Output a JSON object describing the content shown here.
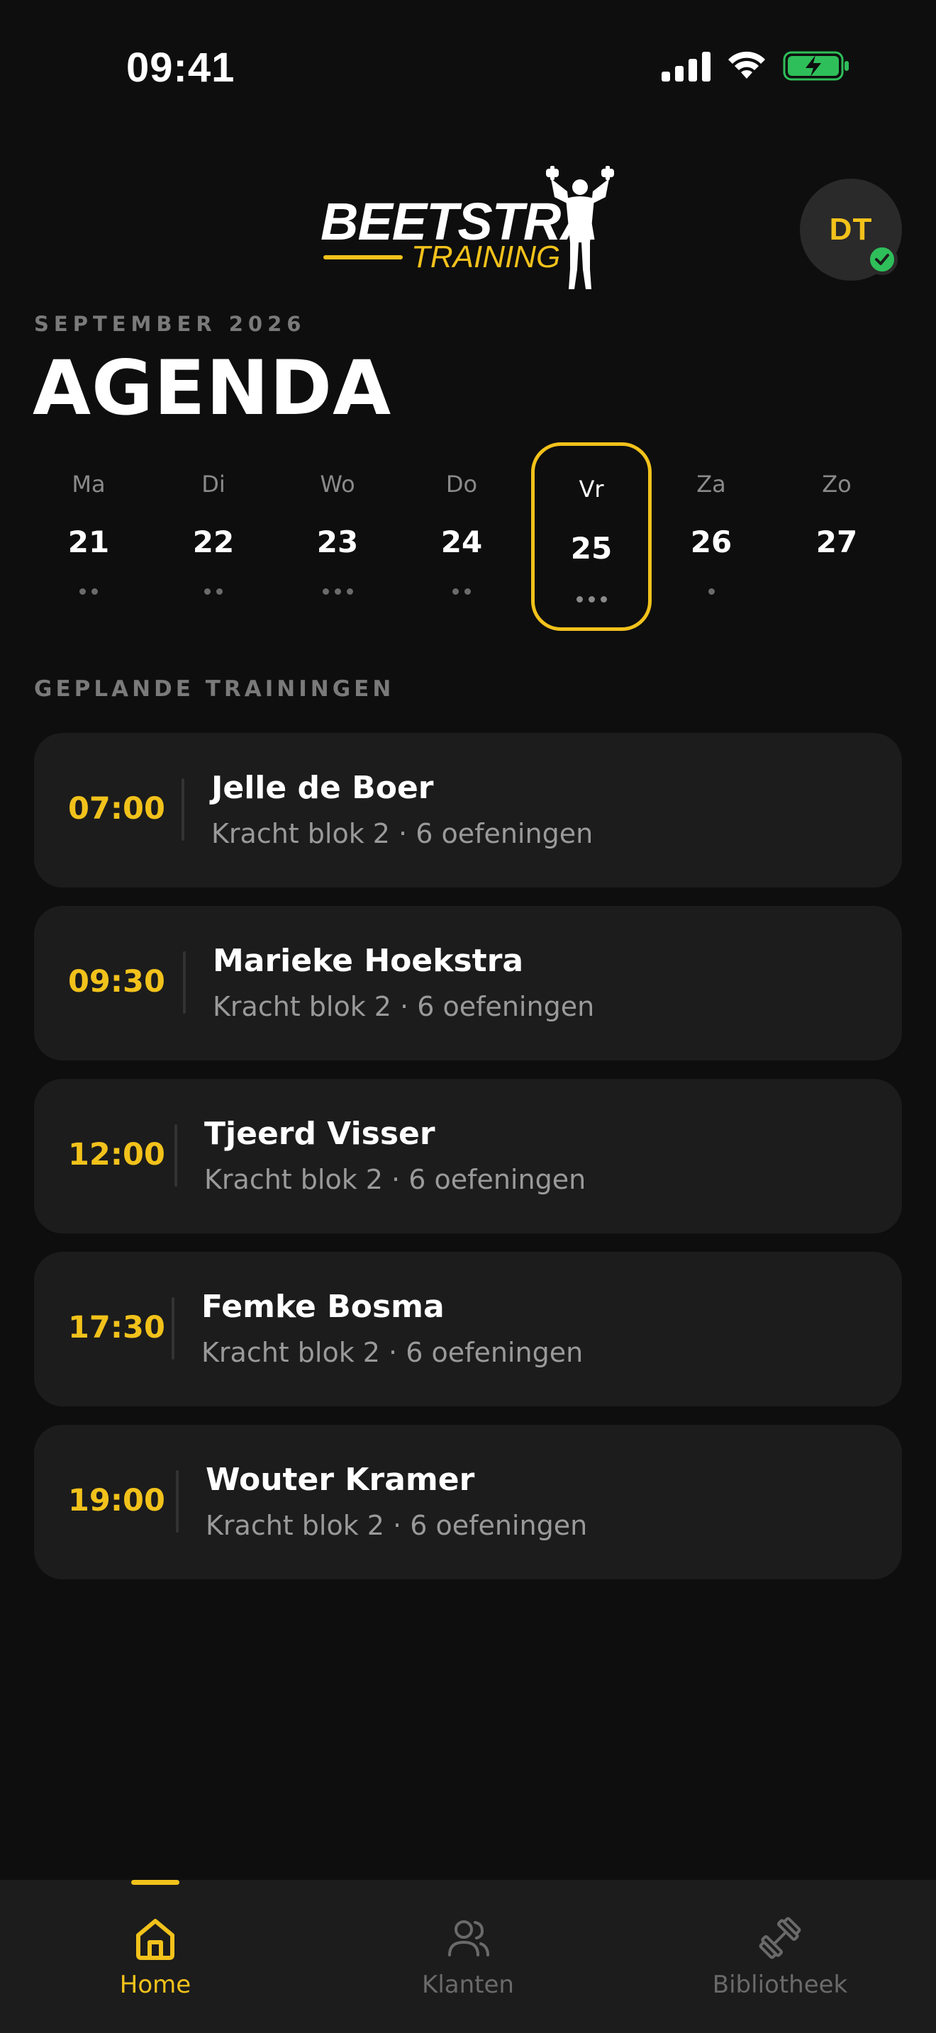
{
  "status_bar": {
    "time": "09:41"
  },
  "header": {
    "logo_word": "BEETSTRA",
    "logo_sub": "TRAINING",
    "avatar_initials": "DT"
  },
  "agenda": {
    "month_label": "SEPTEMBER 2026",
    "title": "AGENDA",
    "week": [
      {
        "name": "Ma",
        "num": "21",
        "dots": 2,
        "selected": false
      },
      {
        "name": "Di",
        "num": "22",
        "dots": 2,
        "selected": false
      },
      {
        "name": "Wo",
        "num": "23",
        "dots": 3,
        "selected": false
      },
      {
        "name": "Do",
        "num": "24",
        "dots": 2,
        "selected": false
      },
      {
        "name": "Vr",
        "num": "25",
        "dots": 3,
        "selected": true
      },
      {
        "name": "Za",
        "num": "26",
        "dots": 1,
        "selected": false
      },
      {
        "name": "Zo",
        "num": "27",
        "dots": 0,
        "selected": false
      }
    ],
    "section_label": "GEPLANDE TRAININGEN",
    "sessions": [
      {
        "time": "07:00",
        "client": "Jelle de Boer",
        "details": "Kracht blok 2 · 6 oefeningen"
      },
      {
        "time": "09:30",
        "client": "Marieke Hoekstra",
        "details": "Kracht blok 2 · 6 oefeningen"
      },
      {
        "time": "12:00",
        "client": "Tjeerd Visser",
        "details": "Kracht blok 2 · 6 oefeningen"
      },
      {
        "time": "17:30",
        "client": "Femke Bosma",
        "details": "Kracht blok 2 · 6 oefeningen"
      },
      {
        "time": "19:00",
        "client": "Wouter Kramer",
        "details": "Kracht blok 2 · 6 oefeningen"
      }
    ]
  },
  "nav": {
    "items": [
      {
        "label": "Home",
        "icon": "home-icon",
        "active": true
      },
      {
        "label": "Klanten",
        "icon": "users-icon",
        "active": false
      },
      {
        "label": "Bibliotheek",
        "icon": "dumbbell-icon",
        "active": false
      }
    ]
  },
  "colors": {
    "accent": "#f2c21b",
    "background": "#0e0e0e",
    "card": "#1c1c1c",
    "success": "#2fbf5a"
  }
}
